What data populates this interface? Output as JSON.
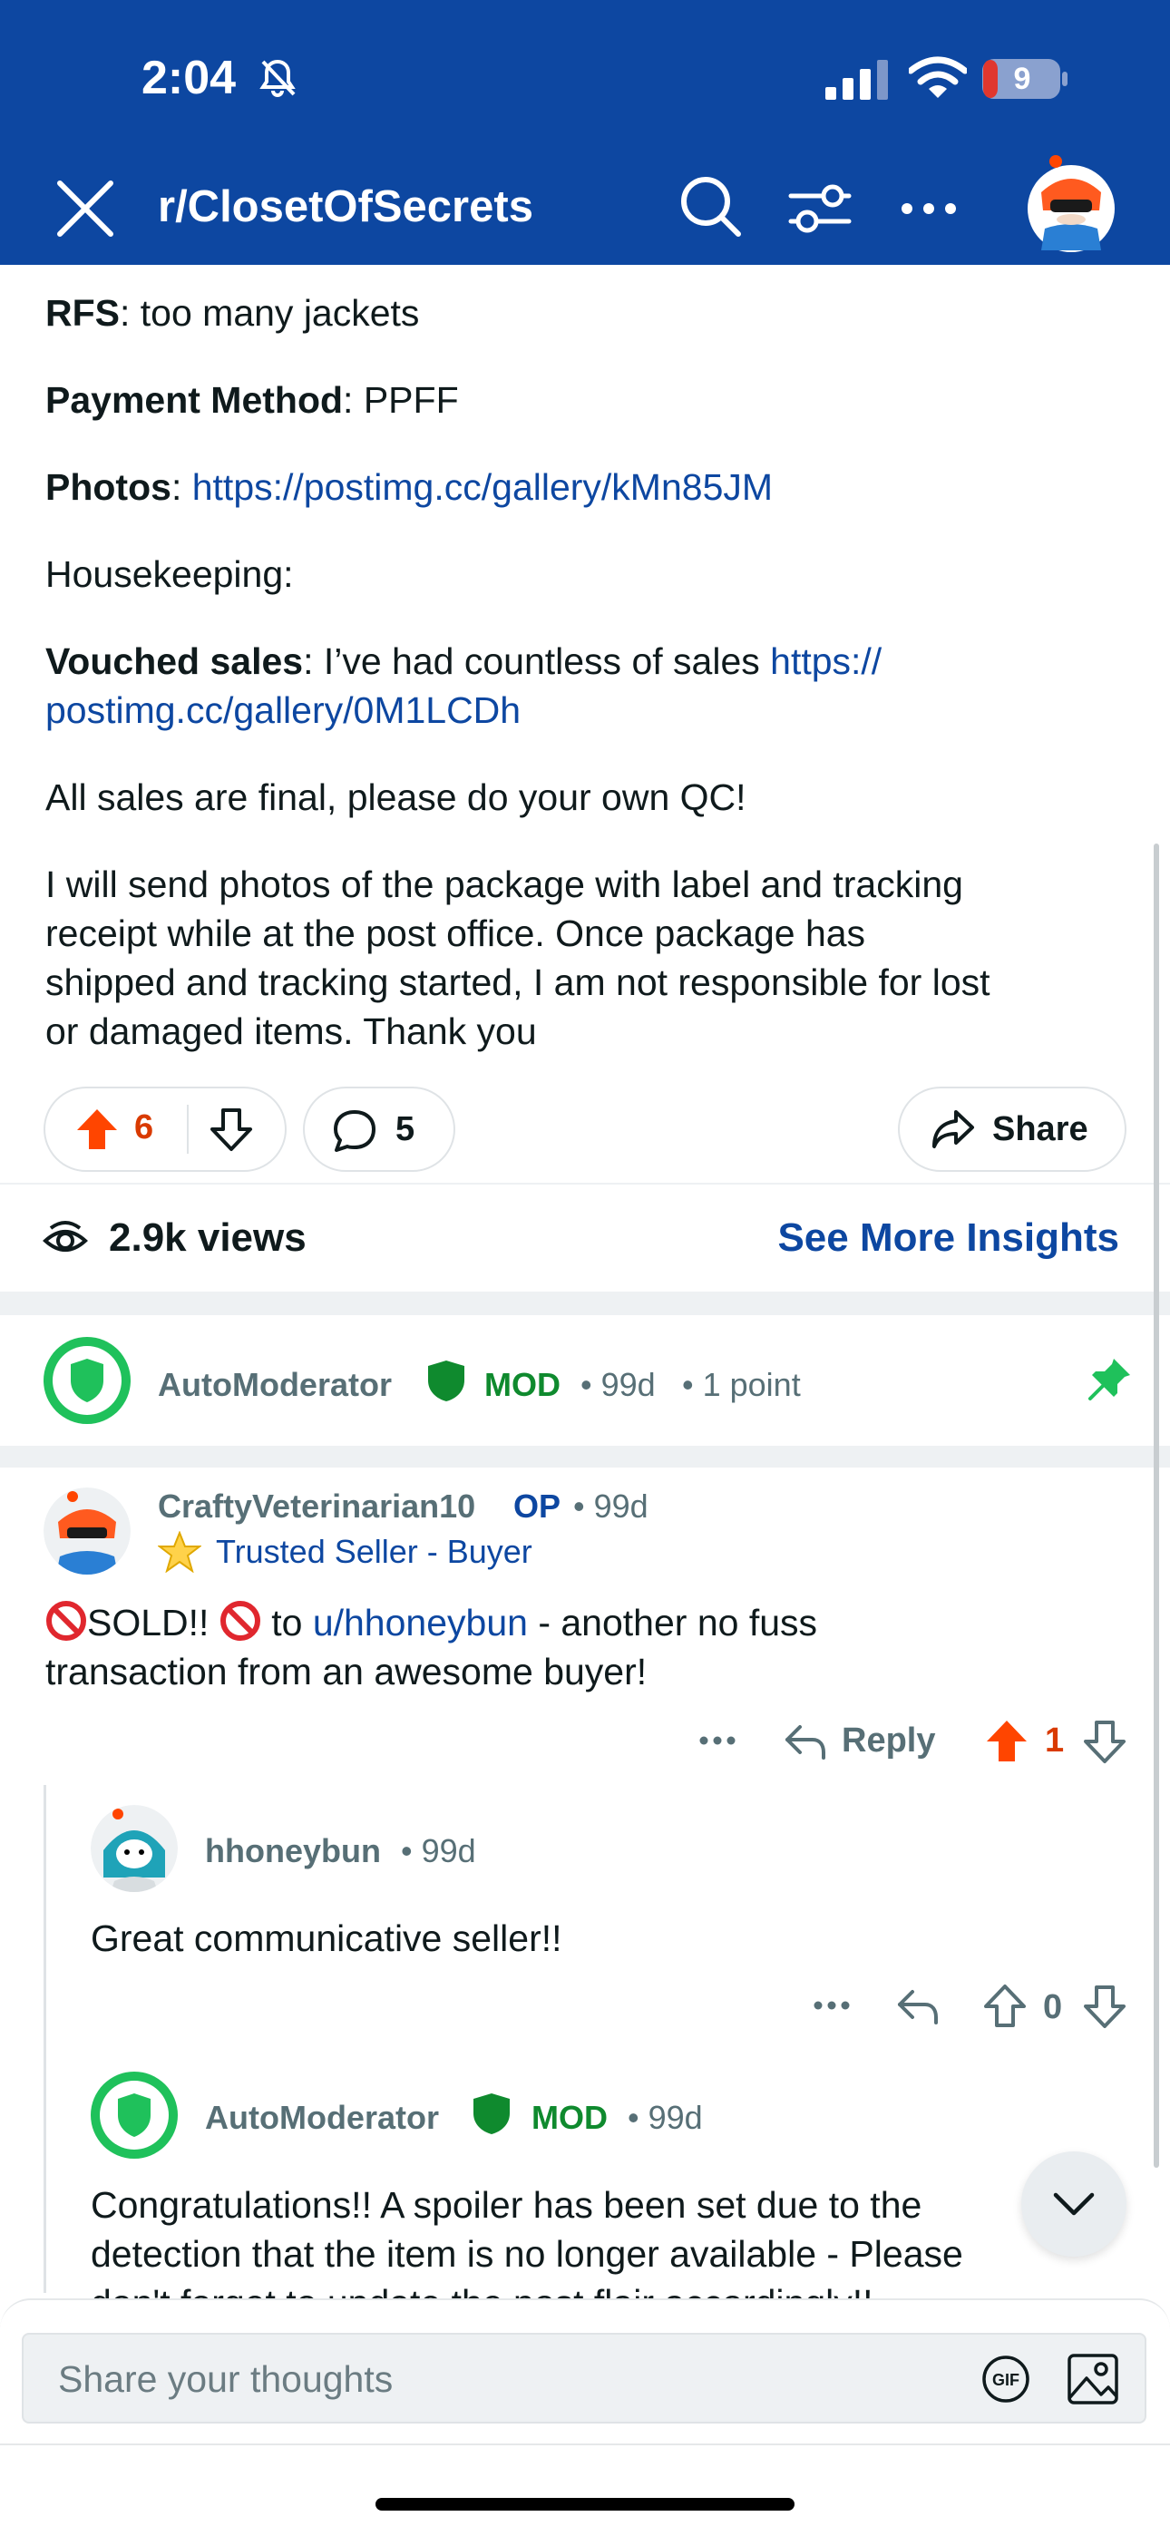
{
  "status_bar": {
    "time": "2:04",
    "battery_level": "9"
  },
  "header": {
    "subreddit": "r/ClosetOfSecrets"
  },
  "post": {
    "rfs_label": "RFS",
    "rfs_value": ": too many jackets",
    "payment_label": "Payment Method",
    "payment_value": ": PPFF",
    "photos_label": "Photos",
    "photos_sep": ": ",
    "photos_link": "https://postimg.cc/gallery/kMn85JM",
    "housekeeping": "Housekeeping:",
    "vouched_label": "Vouched sales",
    "vouched_value": ": I’ve had countless of sales ",
    "vouched_link_1": "https://",
    "vouched_link_2": "postimg.cc/gallery/0M1LCDh",
    "final_sales": "All sales are final, please do your own QC!",
    "shipping_1": "I will send photos of the package with label and tracking",
    "shipping_2": "receipt while at the post office. Once package has",
    "shipping_3": "shipped and tracking started, I am not responsible for lost",
    "shipping_4": "or damaged items. Thank you",
    "upvotes": "6",
    "comments": "5",
    "share_label": "Share",
    "views": "2.9k views",
    "insights_label": "See More Insights"
  },
  "comments": {
    "automod_top": {
      "author": "AutoModerator",
      "mod_label": "MOD",
      "age": "• 99d",
      "points": "• 1 point"
    },
    "op_comment": {
      "author": "CraftyVeterinarian10",
      "op_label": "OP",
      "age": "• 99d",
      "flair": "Trusted Seller - Buyer",
      "text_sold": "SOLD!! ",
      "text_to": " to ",
      "user_link": "u/hhoneybun",
      "text_rest_1": " - another no fuss",
      "text_rest_2": "transaction from an awesome buyer!",
      "reply_label": "Reply",
      "score": "1"
    },
    "reply_hhoneybun": {
      "author": "hhoneybun",
      "age": "• 99d",
      "text": "Great communicative seller!!",
      "score": "0"
    },
    "automod_reply": {
      "author": "AutoModerator",
      "mod_label": "MOD",
      "age": "• 99d",
      "text_1": "Congratulations!! A spoiler has been set due to the",
      "text_2": "detection that the item is no longer available - Please",
      "text_3": "don't forget to update the post flair accordingly!!"
    }
  },
  "composer": {
    "placeholder": "Share your thoughts"
  },
  "colors": {
    "header_bg": "#0d47a1",
    "upvote": "#ff4500",
    "link": "#0d47a1",
    "mod_green": "#0f8a2e"
  },
  "icons": [
    "close-icon",
    "search-icon",
    "filter-icon",
    "more-icon",
    "upvote-icon",
    "downvote-icon",
    "comment-icon",
    "share-icon",
    "views-icon",
    "shield-icon",
    "pin-icon",
    "star-icon",
    "reply-icon",
    "chevron-down-icon",
    "gif-icon",
    "image-icon"
  ]
}
